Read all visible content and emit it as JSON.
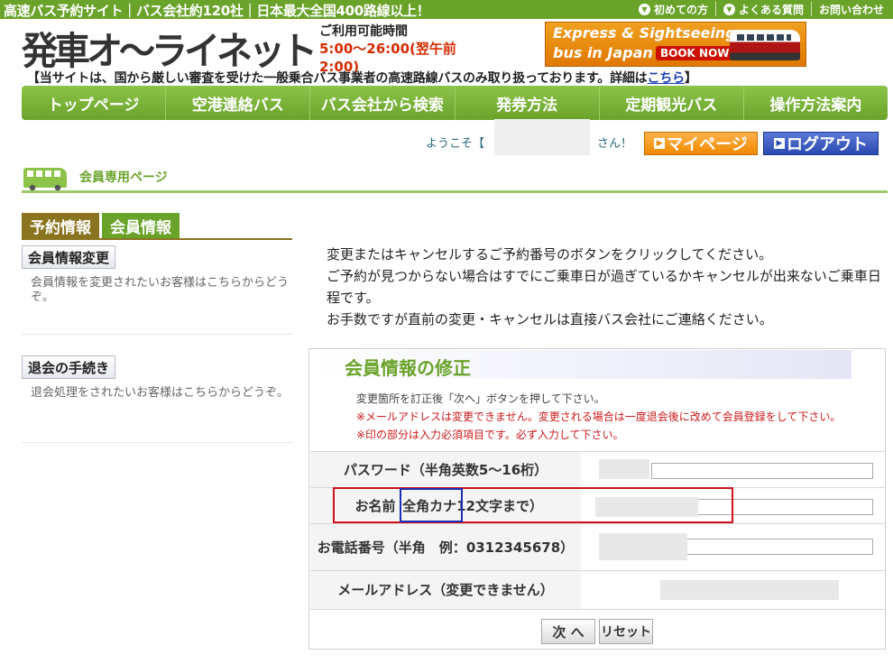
{
  "topbar": {
    "tagline": "高速バス予約サイト｜バス会社約120社｜日本最大全国400路線以上！",
    "links": [
      {
        "label": "初めての方",
        "icon": "chevron-down-icon"
      },
      {
        "label": "よくある質問",
        "icon": "chevron-down-icon"
      },
      {
        "label": "お問い合わせ"
      }
    ]
  },
  "header": {
    "logo_text": "発車オ〜ライネット",
    "hours_label": "ご利用可能時間",
    "hours_value": "5:00〜26:00(翌午前2:00)",
    "banner": {
      "line1": "Express & Sightseeing",
      "line2": "bus in Japan",
      "button": "BOOK NOW!"
    },
    "notice_text": "【当サイトは、国から厳しい審査を受けた一般乗合バス事業者の高速路線バスのみ取り扱っております。詳細は",
    "notice_link": "こちら",
    "notice_end": "】"
  },
  "nav": {
    "items": [
      "トップページ",
      "空港連絡バス",
      "バス会社から検索",
      "発券方法",
      "定期観光バス",
      "操作方法案内"
    ]
  },
  "welcome": {
    "prefix": "ようこそ【",
    "suffix": "さん！",
    "mypage_label": "マイページ",
    "logout_label": "ログアウト"
  },
  "member": {
    "title": "会員専用ページ"
  },
  "tabs": [
    {
      "label": "予約情報",
      "active": true
    },
    {
      "label": "会員情報",
      "active": false
    }
  ],
  "sidebar": {
    "items": [
      {
        "button": "会員情報変更",
        "desc": "会員情報を変更されたいお客様はこちらからどうぞ。"
      },
      {
        "button": "退会の手続き",
        "desc": "退会処理をされたいお客様はこちらからどうぞ。"
      }
    ]
  },
  "instructions": {
    "line1": "変更またはキャンセルするご予約番号のボタンをクリックしてください。",
    "line2": "ご予約が見つからない場合はすでにご乗車日が過ぎているかキャンセルが出来ないご乗車日程です。",
    "line3": "お手数ですが直前の変更・キャンセルは直接バス会社にご連絡ください。"
  },
  "form": {
    "title": "会員情報の修正",
    "note1": "変更箇所を訂正後「次へ」ボタンを押して下さい。",
    "note2": "※メールアドレスは変更できません。変更される場合は一度退会後に改めて会員登録をして下さい。",
    "note3": "※印の部分は入力必須項目です。必ず入力して下さい。",
    "fields": [
      {
        "label": "パスワード（半角英数5〜16桁）"
      },
      {
        "label_pre": "お名前　",
        "label_kana": "全角カナ",
        "label_post": "12文字まで）"
      },
      {
        "label_line1": "お電話番号（半角　例：",
        "label_line2": "0312345678）"
      },
      {
        "label": "メールアドレス（変更できません）"
      }
    ],
    "next_button": "次 へ",
    "reset_button": "リセット"
  },
  "colors": {
    "brand_green": "#6aa32a",
    "accent_orange": "#f08a00",
    "logout_blue": "#2a4ab0",
    "highlight_red": "#d0121b",
    "highlight_blue": "#1a2fb5"
  }
}
